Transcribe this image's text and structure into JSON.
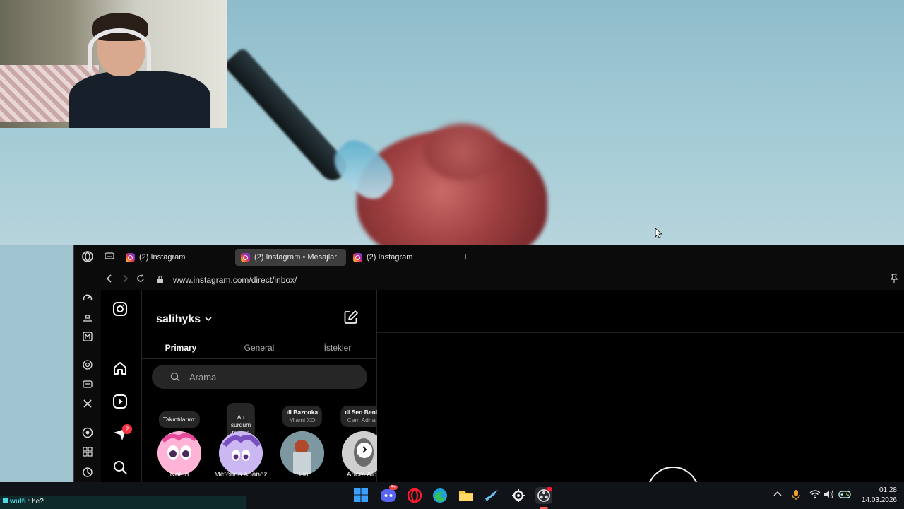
{
  "browser": {
    "tabs": [
      {
        "label": "(2) Instagram"
      },
      {
        "label": "(2) Instagram • Mesajlar"
      },
      {
        "label": "(2) Instagram"
      }
    ],
    "url": "www.instagram.com/direct/inbox/"
  },
  "dm": {
    "username": "salihyks",
    "tabs": [
      "Primary",
      "General",
      "İstekler"
    ],
    "search_placeholder": "Arama",
    "notes": [
      {
        "bubble": "Takıntılarım:",
        "sub": "",
        "label": "Notun"
      },
      {
        "bubble": "Atı sürdüm\ntaşlığa soxum\nböyle...",
        "sub": "",
        "label": "Metehan Abanoz"
      },
      {
        "bubble": "ıll Bazooka",
        "sub": "Miami XO",
        "label": "Sıla"
      },
      {
        "bubble": "ıll Sen Benim",
        "sub": "Cem Adrian,",
        "label": "Adem Alde"
      }
    ],
    "notifications_badge": "2"
  },
  "chat": {
    "user": "wulfi",
    "message": " : he?"
  },
  "taskbar": {
    "discord_badge": "9+",
    "time": "01:28",
    "date": "14.03.2026"
  },
  "colors": {
    "accent": "#ff3040",
    "tab_active": "#3d3d3d",
    "background": "#000000"
  }
}
